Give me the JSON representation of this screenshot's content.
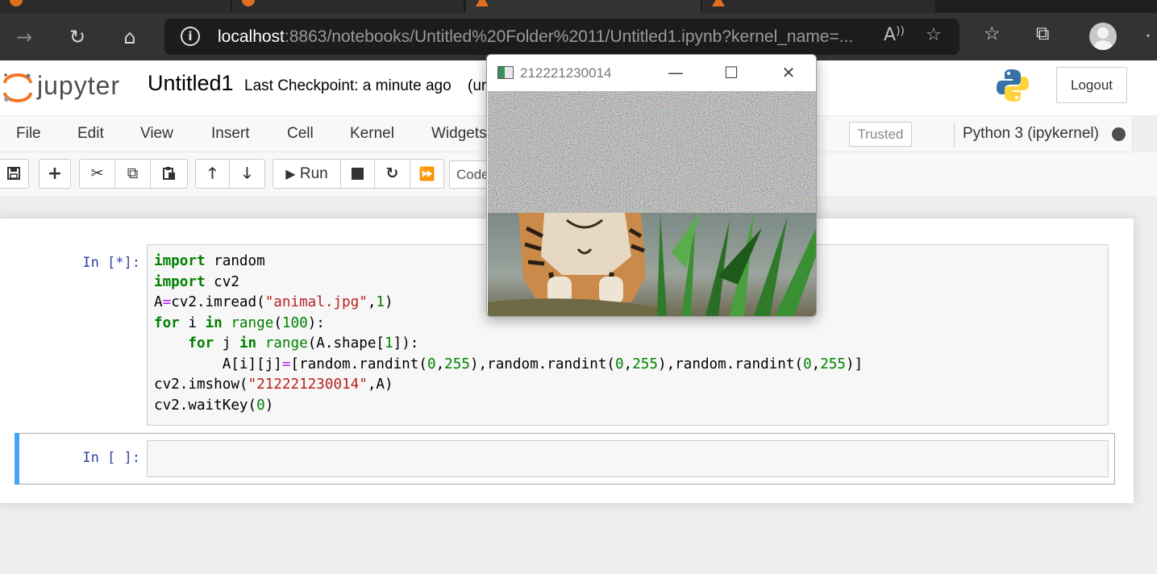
{
  "browser": {
    "url_host": "localhost",
    "url_rest": ":8863/notebooks/Untitled%20Folder%2011/Untitled1.ipynb?kernel_name=..."
  },
  "jupyter": {
    "logo_text": "jupyter",
    "notebook_title": "Untitled1",
    "checkpoint": "Last Checkpoint: a minute ago",
    "unsaved_partial": "(ur",
    "logout_label": "Logout"
  },
  "menubar": {
    "items": [
      "File",
      "Edit",
      "View",
      "Insert",
      "Cell",
      "Kernel",
      "Widgets"
    ],
    "trusted_label": "Trusted",
    "kernel_label": "Python 3 (ipykernel)"
  },
  "toolbar": {
    "run_label": "Run",
    "cell_type": "Code"
  },
  "cells": [
    {
      "prompt": "In [*]:",
      "code": [
        "import random",
        "import cv2",
        "A=cv2.imread(\"animal.jpg\",1)",
        "for i in range(100):",
        "    for j in range(A.shape[1]):",
        "        A[i][j]=[random.randint(0,255),random.randint(0,255),random.randint(0,255)]",
        "cv2.imshow(\"212221230014\",A)",
        "cv2.waitKey(0)"
      ]
    },
    {
      "prompt": "In [ ]:",
      "code": []
    }
  ],
  "cv_window": {
    "title": "212221230014",
    "minimize": "—",
    "maximize": "☐",
    "close": "✕"
  },
  "colors": {
    "prompt": "#303f9f",
    "selected_bar": "#42a5f5",
    "keyword": "#008000",
    "string": "#ba2121"
  }
}
